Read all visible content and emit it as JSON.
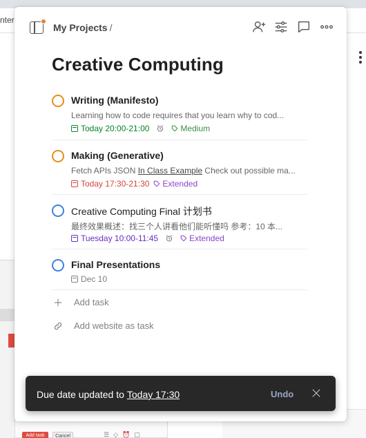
{
  "background": {
    "url_fragment": "ntere",
    "add_task_btn": "Add task",
    "cancel_btn": "Cancel"
  },
  "header": {
    "breadcrumb": "My Projects",
    "breadcrumb_sep": "/",
    "icons": [
      "sidebar-toggle-icon",
      "add-person-icon",
      "sliders-icon",
      "comment-icon",
      "more-icon"
    ],
    "notification_dot_color": "#e8832f"
  },
  "project": {
    "title": "Creative Computing"
  },
  "tasks": [
    {
      "title": "Writing (Manifesto)",
      "bold": true,
      "check_color": "#e58e1a",
      "description": "Learning how to code requires that you learn why to cod...",
      "date": "Today 20:00-21:00",
      "date_color": "#058527",
      "has_alarm": true,
      "label": "Medium",
      "label_color": "#3f8d3f"
    },
    {
      "title": "Making (Generative)",
      "bold": true,
      "check_color": "#e58e1a",
      "description_prefix": "Fetch APIs JSON ",
      "description_link": "In Class Example",
      "description_suffix": " Check out possible ma...",
      "date": "Today 17:30-21:30",
      "date_color": "#d1453b",
      "has_alarm": false,
      "label": "Extended",
      "label_color": "#8b45c8"
    },
    {
      "title": "Creative Computing Final 计划书",
      "bold": false,
      "check_color": "#3d7fe0",
      "description": "最终效果概述：找三个人讲看他们能听懂吗 参考：10 本...",
      "date": "Tuesday 10:00-11:45",
      "date_color": "#692ec2",
      "has_alarm": true,
      "label": "Extended",
      "label_color": "#8b45c8"
    },
    {
      "title": "Final Presentations",
      "bold": true,
      "check_color": "#3d7fe0",
      "date": "Dec 10",
      "date_color": "#808080"
    }
  ],
  "actions": {
    "add_task": "Add task",
    "add_website": "Add website as task"
  },
  "toast": {
    "message": "Due date updated to",
    "link": "Today 17:30",
    "undo": "Undo"
  }
}
